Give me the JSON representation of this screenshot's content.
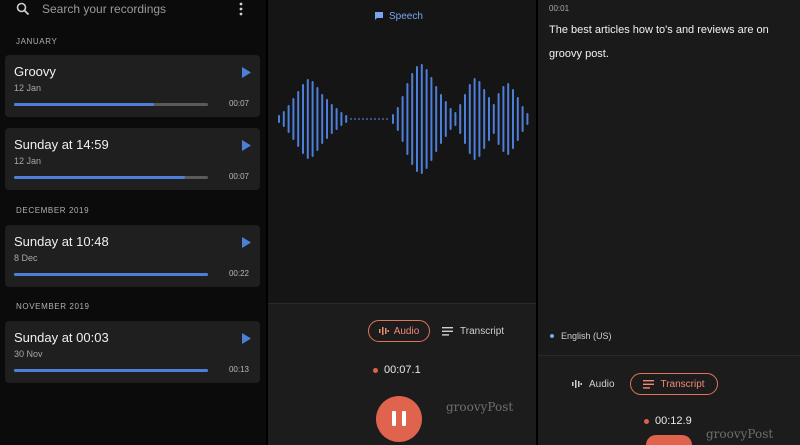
{
  "list": {
    "search_placeholder": "Search your recordings",
    "sections": [
      {
        "header": "JANUARY",
        "items": [
          {
            "title": "Groovy",
            "date": "12 Jan",
            "duration": "00:07",
            "progress": 0.72
          },
          {
            "title": "Sunday at 14:59",
            "date": "12 Jan",
            "duration": "00:07",
            "progress": 0.88
          }
        ]
      },
      {
        "header": "DECEMBER 2019",
        "items": [
          {
            "title": "Sunday at 10:48",
            "date": "8 Dec",
            "duration": "00:22",
            "progress": 1.0
          }
        ]
      },
      {
        "header": "NOVEMBER 2019",
        "items": [
          {
            "title": "Sunday at 00:03",
            "date": "30 Nov",
            "duration": "00:13",
            "progress": 1.0
          }
        ]
      }
    ]
  },
  "player": {
    "speech_label": "Speech",
    "tab_audio": "Audio",
    "tab_transcript": "Transcript",
    "elapsed": "00:07.1",
    "watermark": "groovyPost"
  },
  "transcript": {
    "timestamp": "00:01",
    "text": "The best articles how to's and reviews are on groovy post.",
    "language": "English (US)",
    "tab_audio": "Audio",
    "tab_transcript": "Transcript",
    "elapsed": "00:12.9",
    "watermark": "groovyPost"
  },
  "colors": {
    "accent_blue": "#4e7fd8",
    "record_red": "#e0634d"
  }
}
